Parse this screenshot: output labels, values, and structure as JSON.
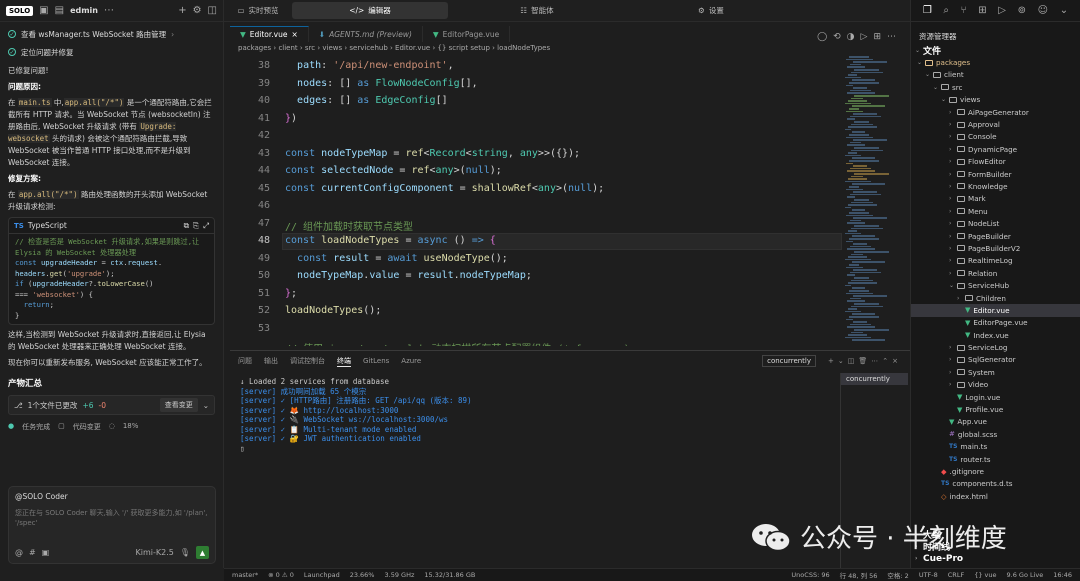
{
  "left": {
    "header": {
      "solo": "SOLO",
      "user": "edmin"
    },
    "tasks": [
      {
        "label": "查看 wsManager.ts WebSocket 路由管理"
      },
      {
        "label": "定位问题并修复"
      }
    ],
    "fixed": "已修复问题!",
    "cause_title": "问题原因:",
    "cause_text_1": "在",
    "cause_code_1": "main.ts",
    "cause_text_2": "中,",
    "cause_code_2": "app.all(\"/*\")",
    "cause_text_3": "是一个通配符路由,它会拦截所有 HTTP 请求。当 WebSocket 节点 (websocketIn) 注册路由后, WebSocket 升级请求 (带有",
    "cause_code_3": "Upgrade: websocket",
    "cause_text_4": "头的请求) 会被这个通配符路由拦截,导致 WebSocket 被当作普通 HTTP 接口处理,而不是升级到 WebSocket 连接。",
    "fix_title": "修复方案:",
    "fix_text_1": "在",
    "fix_code": "app.all(\"/*\")",
    "fix_text_2": "路由处理函数的开头添加 WebSocket 升级请求检测:",
    "codebox": {
      "lang": "TypeScript",
      "lines": [
        "// 检查是否是 WebSocket 升级请求,如果是则跳过,让 Elysia 的 WebSocket 处理器处理",
        "const upgradeHeader = ctx.request.headers.get('upgrade');",
        "if (upgradeHeader?.toLowerCase() === 'websocket') {",
        "  return;",
        "}"
      ]
    },
    "after_1": "这样,当检测到 WebSocket 升级请求时,直接返回,让 Elysia 的 WebSocket 处理器来正确处理 WebSocket 连接。",
    "after_2": "现在你可以重新发布服务, WebSocket 应该能正常工作了。",
    "summary_title": "产物汇总",
    "file_change": {
      "label": "1个文件已更改",
      "plus": "+6",
      "minus": "-0",
      "btn": "查看变更"
    },
    "progress": {
      "done": "任务完成",
      "code": "代码变更",
      "pct": "18%"
    },
    "chat": {
      "title": "@SOLO Coder",
      "placeholder": "您正在与 SOLO Coder 聊天,输入 '/' 获取更多能力,如 '/plan', '/spec'",
      "model": "Kimi-K2.5"
    }
  },
  "topbar": {
    "tabs": [
      "实时预览",
      "编辑器",
      "智能体",
      "设置"
    ],
    "active": 1
  },
  "editor_tabs": [
    {
      "label": "Editor.vue",
      "active": true
    },
    {
      "label": "AGENTS.md (Preview)",
      "active": false,
      "italic": true
    },
    {
      "label": "EditorPage.vue",
      "active": false
    }
  ],
  "breadcrumb": "packages › client › src › views › servicehub › Editor.vue › {} script setup › loadNodeTypes",
  "code": {
    "numbers": [
      "38",
      "39",
      "40",
      "41",
      "42",
      "43",
      "44",
      "45",
      "46",
      "47",
      "48",
      "49",
      "50",
      "51",
      "52",
      "53"
    ],
    "current": "48"
  },
  "terminal": {
    "tabs": [
      "问题",
      "输出",
      "调试控制台",
      "终端",
      "GitLens",
      "Azure"
    ],
    "active": 3,
    "session": "concurrently",
    "lines": [
      "↓ Loaded 2 services from database",
      "[server] 成功啊间加载 65 个模宗",
      "[server] ✓ [HTTP路由] 注册路由: GET /api/qq (版本: 89)",
      "[server] ✓ 🦊 http://localhost:3000",
      "[server] ✓ 🔌 WebSocket ws://localhost:3000/ws",
      "[server] ✓ 📋 Multi-tenant mode enabled",
      "[server] ✓ 🔐 JWT authentication enabled"
    ]
  },
  "explorer": {
    "title": "资源管理器",
    "section": "文件",
    "items": [
      {
        "label": "packages",
        "type": "folder",
        "depth": 0,
        "open": true,
        "color": "#e2c08d"
      },
      {
        "label": "client",
        "type": "folder",
        "depth": 1,
        "open": true
      },
      {
        "label": "src",
        "type": "folder",
        "depth": 2,
        "open": true
      },
      {
        "label": "views",
        "type": "folder",
        "depth": 3,
        "open": true
      },
      {
        "label": "AiPageGenerator",
        "type": "folder",
        "depth": 4
      },
      {
        "label": "Approval",
        "type": "folder",
        "depth": 4
      },
      {
        "label": "Console",
        "type": "folder",
        "depth": 4
      },
      {
        "label": "DynamicPage",
        "type": "folder",
        "depth": 4
      },
      {
        "label": "FlowEditor",
        "type": "folder",
        "depth": 4
      },
      {
        "label": "FormBuilder",
        "type": "folder",
        "depth": 4
      },
      {
        "label": "Knowledge",
        "type": "folder",
        "depth": 4
      },
      {
        "label": "Mark",
        "type": "folder",
        "depth": 4
      },
      {
        "label": "Menu",
        "type": "folder",
        "depth": 4
      },
      {
        "label": "NodeList",
        "type": "folder",
        "depth": 4
      },
      {
        "label": "PageBuilder",
        "type": "folder",
        "depth": 4
      },
      {
        "label": "PageBuilderV2",
        "type": "folder",
        "depth": 4
      },
      {
        "label": "RealtimeLog",
        "type": "folder",
        "depth": 4
      },
      {
        "label": "Relation",
        "type": "folder",
        "depth": 4
      },
      {
        "label": "ServiceHub",
        "type": "folder",
        "depth": 4,
        "open": true
      },
      {
        "label": "Children",
        "type": "folder",
        "depth": 5
      },
      {
        "label": "Editor.vue",
        "type": "vue",
        "depth": 5,
        "selected": true
      },
      {
        "label": "EditorPage.vue",
        "type": "vue",
        "depth": 5
      },
      {
        "label": "Index.vue",
        "type": "vue",
        "depth": 5
      },
      {
        "label": "ServiceLog",
        "type": "folder",
        "depth": 4
      },
      {
        "label": "SqlGenerator",
        "type": "folder",
        "depth": 4
      },
      {
        "label": "System",
        "type": "folder",
        "depth": 4
      },
      {
        "label": "Video",
        "type": "folder",
        "depth": 4
      },
      {
        "label": "Login.vue",
        "type": "vue",
        "depth": 4
      },
      {
        "label": "Profile.vue",
        "type": "vue",
        "depth": 4
      },
      {
        "label": "App.vue",
        "type": "vue",
        "depth": 3
      },
      {
        "label": "global.scss",
        "type": "scss",
        "depth": 3
      },
      {
        "label": "main.ts",
        "type": "ts",
        "depth": 3
      },
      {
        "label": "router.ts",
        "type": "ts",
        "depth": 3
      },
      {
        "label": ".gitignore",
        "type": "git",
        "depth": 2
      },
      {
        "label": "components.d.ts",
        "type": "ts",
        "depth": 2
      },
      {
        "label": "index.html",
        "type": "html",
        "depth": 2
      }
    ],
    "bottom": [
      "大纲",
      "时间线",
      "Cue-Pro"
    ]
  },
  "status": {
    "left": [
      "master*",
      "⊗ 0 ⚠ 0",
      "Launchpad",
      "23.66%",
      "3.59 GHz",
      "15.32/31.86 GB"
    ],
    "right": [
      "UnoCSS: 96",
      "行 48, 列 56",
      "空格: 2",
      "UTF-8",
      "CRLF",
      "{} vue",
      "9.6 Go Live",
      "16:46"
    ]
  },
  "watermark": "公众号 · 半刻维度"
}
